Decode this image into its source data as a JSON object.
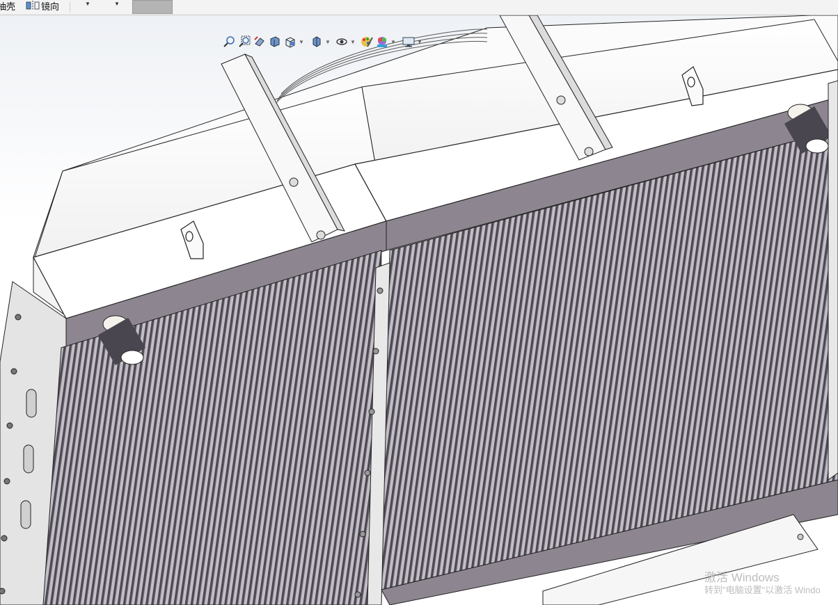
{
  "ribbon": {
    "shell_label": "抽壳",
    "mirror_label": "镜向",
    "dropdown_1": "",
    "dropdown_2": ""
  },
  "heads_up_toolbar": {
    "buttons": [
      "zoom-to-fit-icon",
      "zoom-to-area-icon",
      "previous-view-icon",
      "section-view-icon",
      "view-orientation-icon",
      "display-style-icon",
      "hide-show-items-icon",
      "edit-appearance-icon",
      "apply-scene-icon",
      "view-settings-icon"
    ]
  },
  "watermark": {
    "line1": "激活 Windows",
    "line2": "转到\"电脑设置\"以激活 Windo"
  },
  "colors": {
    "panel_gray": "#8d8690",
    "fin_dark": "#4a4650",
    "fin_light": "#b8b3bb",
    "frame_light": "#e6e6e6",
    "edge": "#2a2a2a"
  }
}
